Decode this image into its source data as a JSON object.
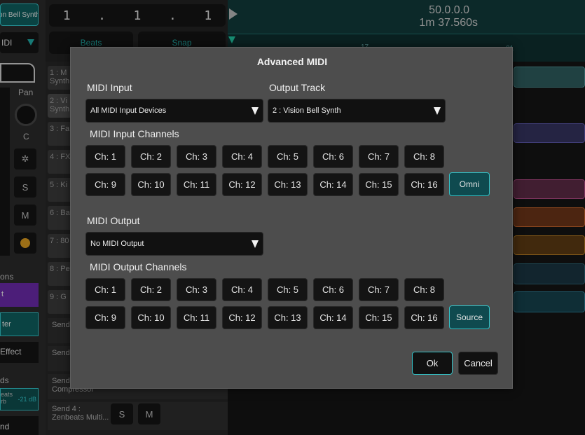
{
  "background": {
    "top_left_label": "on Bell Synth",
    "midi_label": "IDI",
    "lcd": [
      "1",
      ".",
      "1",
      ".",
      "1"
    ],
    "beats_label": "Beats",
    "snap_label": "Snap",
    "position_primary": "50.0.0.0",
    "position_time": "1m 37.560s",
    "pan_label": "Pan",
    "pan_value": "C",
    "solo": "S",
    "mute": "M",
    "ruler_marks": [
      "17",
      "21"
    ],
    "tracks": [
      "1 : M\nSynth",
      "2 : Vi\nSynth",
      "3 : Fa",
      "4 : FX",
      "5 : Ki",
      "6 : Ba",
      "7 : 80",
      "8 : Pe",
      "9 : G"
    ],
    "sends": [
      "Send",
      "Send",
      "Send\nCompressor",
      "Send 4 :\nZenbeats Multi..."
    ],
    "send_s": "S",
    "send_m": "M",
    "left_texts": [
      "ons",
      "t",
      "ter",
      "Effect",
      "ds",
      "eats\nrb",
      "-21 dB",
      "nd"
    ]
  },
  "dialog": {
    "title": "Advanced MIDI",
    "midi_input_label": "MIDI Input",
    "midi_input_value": "All MIDI Input Devices",
    "output_track_label": "Output Track",
    "output_track_value": "2 : Vision Bell Synth",
    "input_channels_label": "MIDI Input Channels",
    "input_channels": [
      "Ch: 1",
      "Ch: 2",
      "Ch: 3",
      "Ch: 4",
      "Ch: 5",
      "Ch: 6",
      "Ch: 7",
      "Ch: 8",
      "Ch: 9",
      "Ch: 10",
      "Ch: 11",
      "Ch: 12",
      "Ch: 13",
      "Ch: 14",
      "Ch: 15",
      "Ch: 16"
    ],
    "omni_label": "Omni",
    "midi_output_label": "MIDI Output",
    "midi_output_value": "No MIDI Output",
    "output_channels_label": "MIDI Output Channels",
    "output_channels": [
      "Ch: 1",
      "Ch: 2",
      "Ch: 3",
      "Ch: 4",
      "Ch: 5",
      "Ch: 6",
      "Ch: 7",
      "Ch: 8",
      "Ch: 9",
      "Ch: 10",
      "Ch: 11",
      "Ch: 12",
      "Ch: 13",
      "Ch: 14",
      "Ch: 15",
      "Ch: 16"
    ],
    "source_label": "Source",
    "ok_label": "Ok",
    "cancel_label": "Cancel"
  },
  "colors": {
    "accent": "#33c1c6",
    "dialog_bg": "#4d4d4d",
    "button_bg": "#141414"
  }
}
